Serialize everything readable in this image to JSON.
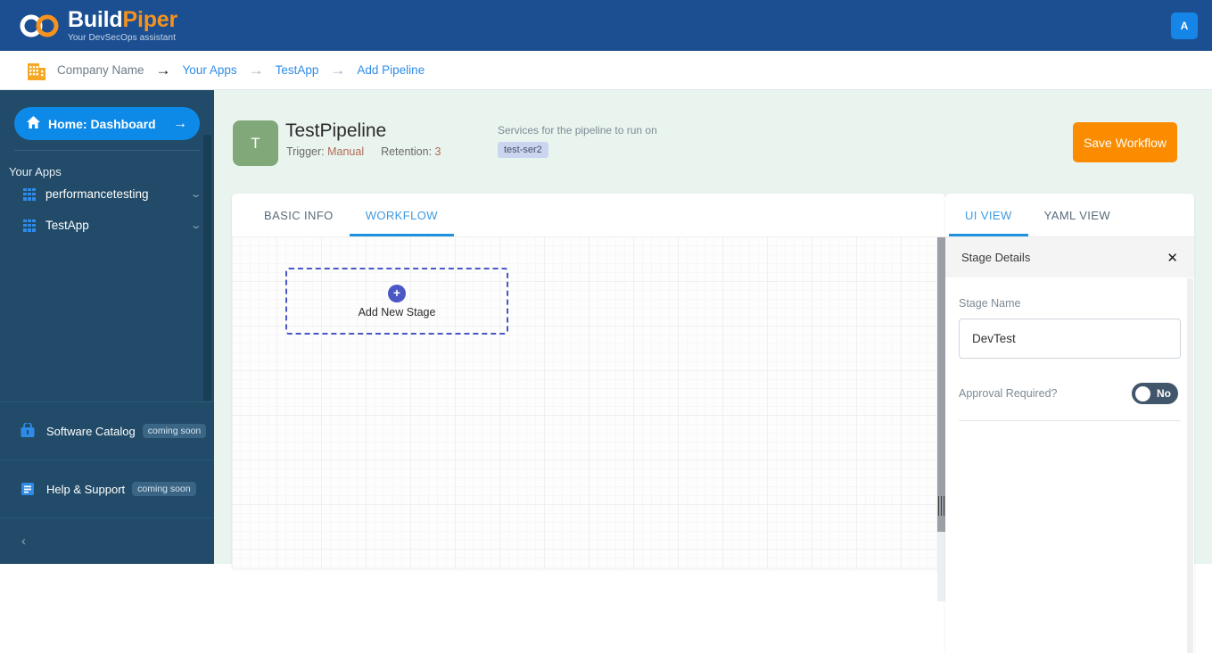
{
  "topbar": {
    "brand_name_part1": "Build",
    "brand_name_part2": "Piper",
    "tagline": "Your DevSecOps assistant",
    "avatar_initial": "A",
    "logo_icon": "infinity-logo-icon",
    "avatar_icon": "user-avatar-icon",
    "background_color": "#1b4f91",
    "accent_color": "#f6921e"
  },
  "breadcrumb": {
    "company_icon": "building-icon",
    "items": [
      {
        "label": "Company Name",
        "type": "muted"
      },
      {
        "label": "Your Apps",
        "type": "link"
      },
      {
        "label": "TestApp",
        "type": "link"
      },
      {
        "label": "Add Pipeline",
        "type": "link"
      }
    ],
    "arrow_glyph": "→"
  },
  "sidebar": {
    "home": {
      "label": "Home: Dashboard",
      "home_icon": "home-icon",
      "arrow_icon": "arrow-right-icon",
      "arrow_glyph": "→",
      "home_glyph": "⌂",
      "background_color": "#0d8ae8"
    },
    "section_label": "Your Apps",
    "apps": [
      {
        "label": "performancetesting",
        "icon": "app-grid-icon",
        "chevron": "chevron-down-icon"
      },
      {
        "label": "TestApp",
        "icon": "app-grid-icon",
        "chevron": "chevron-down-icon"
      }
    ],
    "chevron_glyph": "⌄",
    "bottom_items": [
      {
        "label": "Software Catalog",
        "badge": "coming soon",
        "icon": "basket-icon"
      },
      {
        "label": "Help & Support",
        "badge": "coming soon",
        "icon": "document-icon"
      }
    ],
    "collapse": {
      "icon": "chevron-left-icon",
      "glyph": "‹"
    },
    "background_color": "#214b68"
  },
  "pipeline": {
    "avatar_initial": "T",
    "avatar_color": "#80a878",
    "name": "TestPipeline",
    "trigger_label": "Trigger:",
    "trigger_value": "Manual",
    "retention_label": "Retention:",
    "retention_value": "3",
    "services_label": "Services for the pipeline to run on",
    "service_chip": "test-ser2",
    "save_button": "Save Workflow",
    "save_button_color": "#fb8c00"
  },
  "workflow": {
    "tabs": [
      {
        "label": "BASIC INFO",
        "active": false
      },
      {
        "label": "WORKFLOW",
        "active": true
      }
    ],
    "add_stage": {
      "label": "Add New Stage",
      "plus_icon": "plus-circle-icon",
      "plus_glyph": "+",
      "border_color": "#4a57c4"
    },
    "scrollbar_icon": "vertical-scrollbar",
    "resize_grip_icon": "resize-grip-icon"
  },
  "details_panel": {
    "tabs": [
      {
        "label": "UI VIEW",
        "active": true
      },
      {
        "label": "YAML VIEW",
        "active": false
      }
    ],
    "header_title": "Stage Details",
    "close_icon": "close-icon",
    "close_glyph": "✕",
    "stage_name_label": "Stage Name",
    "stage_name_value": "DevTest",
    "stage_name_placeholder": "Stage Name",
    "approval_label": "Approval Required?",
    "approval_value": "No",
    "approval_toggle_icon": "toggle-switch-icon"
  }
}
